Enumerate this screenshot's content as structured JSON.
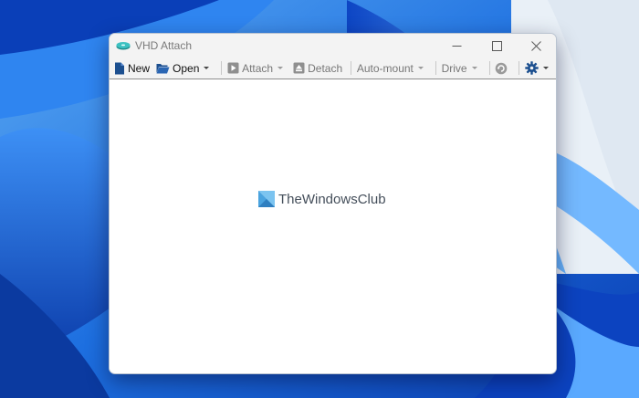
{
  "window": {
    "title": "VHD Attach",
    "minimize_icon": "minimize-icon",
    "maximize_icon": "maximize-icon",
    "close_icon": "close-icon"
  },
  "toolbar": {
    "new_label": "New",
    "open_label": "Open",
    "attach_label": "Attach",
    "detach_label": "Detach",
    "automount_label": "Auto-mount",
    "drive_label": "Drive",
    "refresh_icon": "refresh-icon",
    "settings_icon": "gear-icon"
  },
  "watermark": {
    "text": "TheWindowsClub"
  },
  "colors": {
    "wallpaper": "#1d6fe0",
    "titlebar": "#f3f3f3",
    "toolbar_icon": "#1c4f8f"
  }
}
